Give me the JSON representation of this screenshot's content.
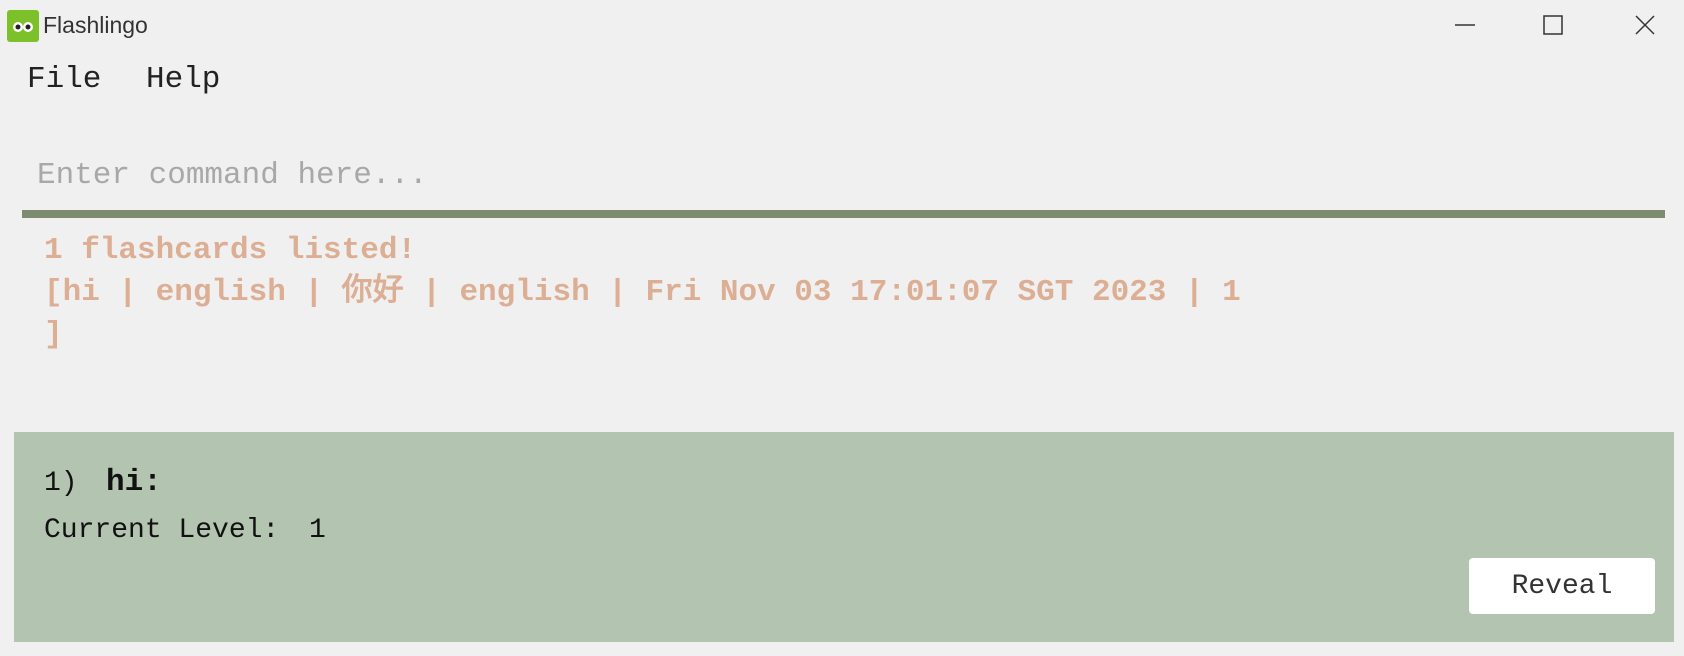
{
  "window": {
    "title": "Flashlingo",
    "icon": "owl-logo-icon",
    "controls": [
      "minimize-icon",
      "maximize-icon",
      "close-icon"
    ]
  },
  "menu": {
    "file": "File",
    "help": "Help"
  },
  "command": {
    "placeholder": "Enter command here...",
    "value": ""
  },
  "result": {
    "line1": "1 flashcards listed!",
    "line2": "[hi | english | 你好 | english | Fri Nov 03 17:01:07 SGT 2023 | 1",
    "line3": "]"
  },
  "flashcards": [
    {
      "index": "1)",
      "word": "hi:",
      "level_label": "Current Level:",
      "level": "1",
      "reveal_label": "Reveal"
    }
  ],
  "colors": {
    "accent_bar": "#7d8c6e",
    "result_text": "#dcae94",
    "card_background": "#b3c4b0",
    "logo_green": "#7cc02a"
  }
}
